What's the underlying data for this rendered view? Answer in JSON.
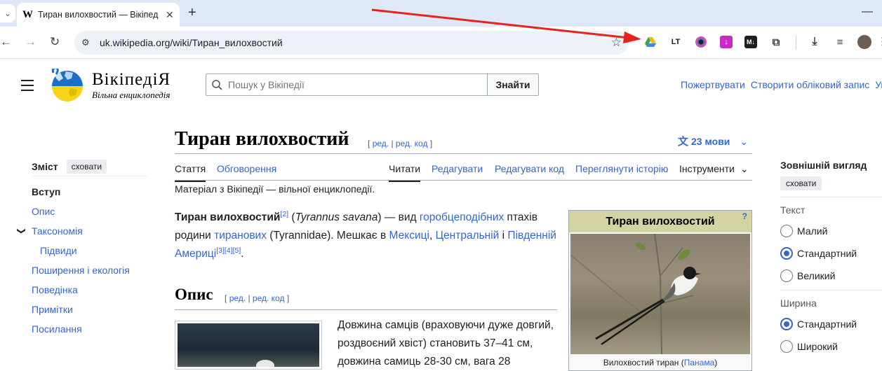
{
  "browser": {
    "tab_title": "Тиран вилохвостий — Вікіпед",
    "tab_favicon": "W",
    "url": "uk.wikipedia.org/wiki/Тиран_вилохвостий",
    "extensions": [
      "google-drive-icon",
      "lt-icon",
      "colorzilla-icon",
      "download-manager-icon",
      "markdown-icon",
      "puzzle-icon"
    ],
    "ext_lt_label": "LT",
    "ext_md_label": "M↓"
  },
  "wiki": {
    "wordmark": "ВікіпедіЯ",
    "tagline": "Вільна енциклопедія",
    "search_placeholder": "Пошук у Вікіпедії",
    "search_button": "Знайти",
    "user_links": [
      "Пожертвувати",
      "Створити обліковий запис",
      "Увійти"
    ]
  },
  "toc": {
    "title": "Зміст",
    "hide": "сховати",
    "items": [
      {
        "label": "Вступ",
        "active": true
      },
      {
        "label": "Опис"
      },
      {
        "label": "Таксономія",
        "expandable": true
      },
      {
        "label": "Підвиди",
        "sub": true
      },
      {
        "label": "Поширення і екологія"
      },
      {
        "label": "Поведінка"
      },
      {
        "label": "Примітки"
      },
      {
        "label": "Посилання"
      }
    ]
  },
  "article": {
    "title": "Тиран вилохвостий",
    "edit_open": "[",
    "edit": "ред.",
    "edit_sep": "|",
    "edit_code": "ред. код",
    "edit_close": "]",
    "languages": "23 мови",
    "tabs_left": [
      "Стаття",
      "Обговорення"
    ],
    "tabs_right": [
      "Читати",
      "Редагувати",
      "Редагувати код",
      "Переглянути історію",
      "Інструменти"
    ],
    "subtitle": "Матеріал з Вікіпедії — вільної енциклопедії.",
    "lead": {
      "name": "Тиран вилохвостий",
      "ref1": "[2]",
      "open_paren": " (",
      "latin": "Tyrannus savana",
      "t1": ") — вид ",
      "l1": "горобцеподібних",
      "t2": " птахів родини ",
      "l2": "тиранових",
      "t3": " (Tyrannidae). Мешкає в ",
      "l3": "Мексиці",
      "t4": ", ",
      "l4": "Центральній",
      "t5": " і ",
      "l5": "Південній Америці",
      "refs": "[3][4][5]",
      "end": "."
    },
    "section_title": "Опис",
    "section_text": "Довжина самців (враховуючи дуже довгий, роздвоєний хвіст) становить 37–41 см, довжина самиць 28-30 см, вага 28"
  },
  "infobox": {
    "title": "Тиран вилохвостий",
    "help": "?",
    "caption_text": "Вилохвостий тиран (",
    "caption_link": "Панама",
    "caption_end": ")"
  },
  "appearance": {
    "title": "Зовнішній вигляд",
    "hide": "сховати",
    "text_label": "Текст",
    "text_options": [
      {
        "label": "Малий",
        "checked": false
      },
      {
        "label": "Стандартний",
        "checked": true
      },
      {
        "label": "Великий",
        "checked": false
      }
    ],
    "width_label": "Ширина",
    "width_options": [
      {
        "label": "Стандартний",
        "checked": true
      },
      {
        "label": "Широкий",
        "checked": false
      }
    ]
  },
  "colors": {
    "link": "#3366cc",
    "annotation_arrow": "#e8231c",
    "infobox_header": "#d3d3a4"
  }
}
